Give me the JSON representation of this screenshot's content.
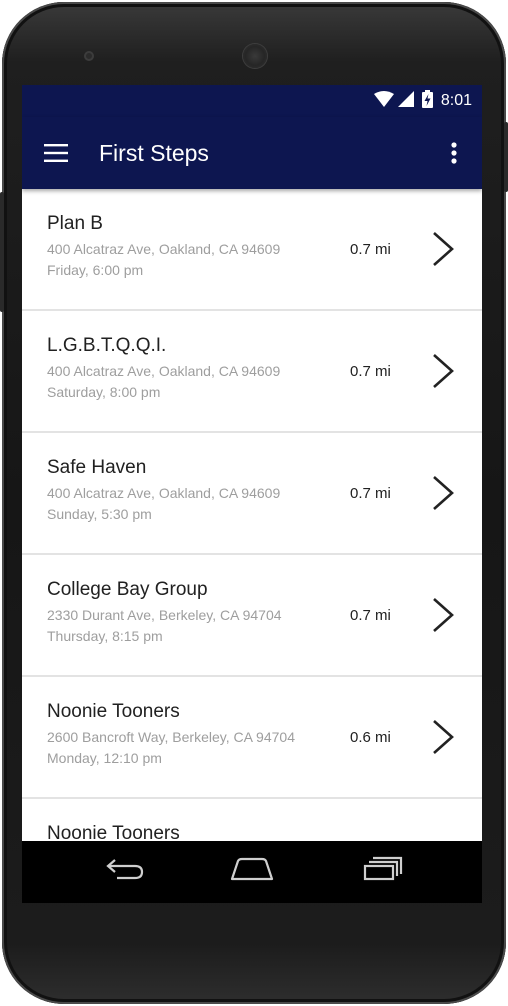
{
  "status_bar": {
    "time": "8:01",
    "icons": [
      "wifi-icon",
      "cell-signal-icon",
      "battery-charging-icon"
    ]
  },
  "app_bar": {
    "title": "First Steps",
    "menu_icon": "hamburger-menu-icon",
    "overflow_icon": "more-vert-icon"
  },
  "meetings": [
    {
      "name": "Plan B",
      "address": "400 Alcatraz Ave, Oakland, CA 94609",
      "time": "Friday, 6:00 pm",
      "distance": "0.7 mi"
    },
    {
      "name": "L.G.B.T.Q.Q.I.",
      "address": "400 Alcatraz Ave, Oakland, CA 94609",
      "time": "Saturday, 8:00 pm",
      "distance": "0.7 mi"
    },
    {
      "name": "Safe Haven",
      "address": "400 Alcatraz Ave, Oakland, CA 94609",
      "time": "Sunday, 5:30 pm",
      "distance": "0.7 mi"
    },
    {
      "name": "College Bay Group",
      "address": "2330 Durant Ave, Berkeley, CA 94704",
      "time": "Thursday, 8:15 pm",
      "distance": "0.7 mi"
    },
    {
      "name": "Noonie Tooners",
      "address": "2600 Bancroft Way, Berkeley, CA 94704",
      "time": "Monday, 12:10 pm",
      "distance": "0.6 mi"
    },
    {
      "name": "Noonie Tooners",
      "address": "",
      "time": "",
      "distance": ""
    }
  ],
  "nav_bar": {
    "icons": [
      "back-icon",
      "home-icon",
      "recents-icon"
    ]
  },
  "colors": {
    "app_bar": "#0d1650",
    "divider": "#e3e3e3",
    "secondary_text": "#9e9e9e",
    "primary_text": "#212121"
  }
}
